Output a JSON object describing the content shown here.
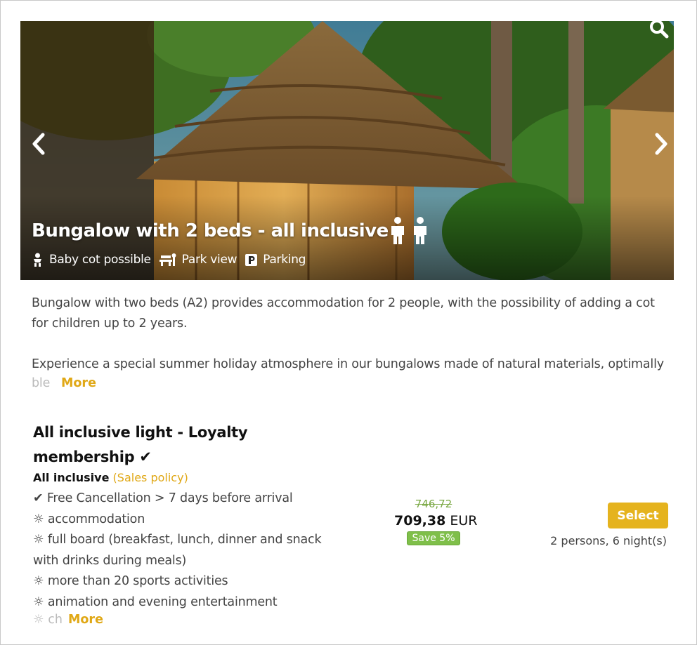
{
  "hero": {
    "title": "Bungalow with 2 beds - all inclusive",
    "amenities": [
      {
        "icon": "baby-icon",
        "label": "Baby cot possible"
      },
      {
        "icon": "bench-icon",
        "label": "Park view"
      },
      {
        "icon": "parking-icon",
        "label": "Parking"
      }
    ],
    "persons_icon": "person-icon",
    "occupancy": 2
  },
  "description": {
    "paragraph1": "Bungalow with two beds (A2) provides accommodation for 2 people, with the possibility of adding a cot for children up to 2 years.",
    "paragraph2": "Experience a special summer holiday atmosphere in our bungalows made of natural materials, optimally",
    "truncated": "ble",
    "more": "More"
  },
  "offer": {
    "title": "All inclusive light - Loyalty membership ✔",
    "board": "All inclusive",
    "policy": "(Sales policy)",
    "features": [
      "✔ Free Cancellation > 7 days before arrival",
      "☼ accommodation",
      "☼ full board (breakfast, lunch, dinner and snack with drinks during meals)",
      "☼ more than 20 sports activities",
      "☼ animation and evening entertainment"
    ],
    "features_truncated": "☼ ch",
    "more": "More",
    "old_price": "746,72",
    "price": "709,38",
    "currency": "EUR",
    "save": "Save 5%",
    "select": "Select",
    "stay": "2 persons, 6 night(s)"
  },
  "colors": {
    "accent": "#e5b31e",
    "save_green": "#7fbf4a",
    "old_price_green": "#7aa843"
  }
}
